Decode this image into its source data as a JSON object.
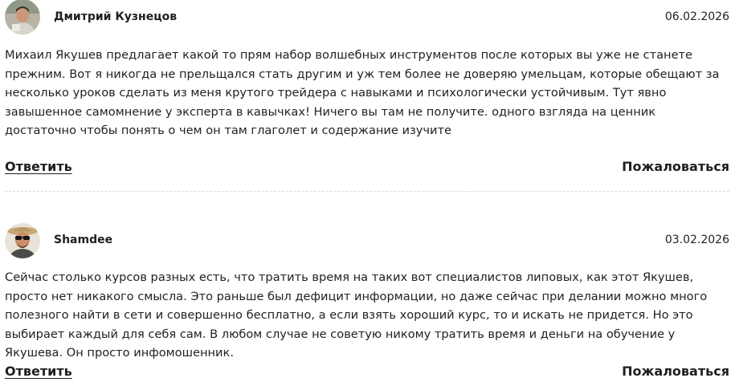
{
  "comments": [
    {
      "author": "Дмитрий Кузнецов",
      "date": "06.02.2026",
      "text": "Михаил Якушев предлагает какой то прям набор волшебных инструментов после которых вы уже не станете прежним. Вот я никогда не прельщался стать другим и уж тем более не доверяю умельцам, которые обещают за несколько уроков сделать из меня крутого трейдера с навыками и психологически устойчивым. Тут явно завышенное самомнение у эксперта в кавычках! Ничего вы там не получите. одного взгляда на ценник достаточно чтобы понять о чем он там глаголет и содержание изучите",
      "reply_label": "Ответить",
      "report_label": "Пожаловаться",
      "avatar": "user-photo-icon"
    },
    {
      "author": "Shamdee",
      "date": "03.02.2026",
      "text": "Сейчас столько курсов разных есть, что тратить время на таких вот специалистов липовых, как этот Якушев, просто нет никакого смысла. Это раньше был дефицит информации, но даже сейчас при делании можно много полезного найти в сети и совершенно бесплатно, а если взять хороший курс, то и искать не придется. Но это выбирает каждый для себя сам. В любом случае не советую никому тратить время и деньги на обучение у Якушева. Он просто инфомошенник.",
      "reply_label": "Ответить",
      "report_label": "Пожаловаться",
      "avatar": "user-photo-icon"
    }
  ],
  "colors": {
    "text": "#222222",
    "divider": "#d9d9d9",
    "background": "#ffffff"
  }
}
